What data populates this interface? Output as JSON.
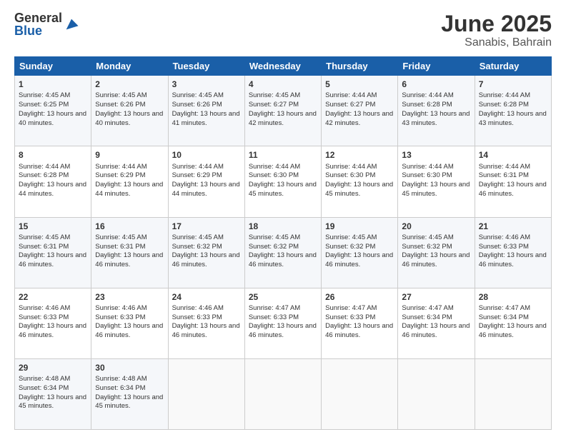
{
  "header": {
    "logo_general": "General",
    "logo_blue": "Blue",
    "month": "June 2025",
    "location": "Sanabis, Bahrain"
  },
  "weekdays": [
    "Sunday",
    "Monday",
    "Tuesday",
    "Wednesday",
    "Thursday",
    "Friday",
    "Saturday"
  ],
  "weeks": [
    [
      {
        "day": "1",
        "sunrise": "Sunrise: 4:45 AM",
        "sunset": "Sunset: 6:25 PM",
        "daylight": "Daylight: 13 hours and 40 minutes."
      },
      {
        "day": "2",
        "sunrise": "Sunrise: 4:45 AM",
        "sunset": "Sunset: 6:26 PM",
        "daylight": "Daylight: 13 hours and 40 minutes."
      },
      {
        "day": "3",
        "sunrise": "Sunrise: 4:45 AM",
        "sunset": "Sunset: 6:26 PM",
        "daylight": "Daylight: 13 hours and 41 minutes."
      },
      {
        "day": "4",
        "sunrise": "Sunrise: 4:45 AM",
        "sunset": "Sunset: 6:27 PM",
        "daylight": "Daylight: 13 hours and 42 minutes."
      },
      {
        "day": "5",
        "sunrise": "Sunrise: 4:44 AM",
        "sunset": "Sunset: 6:27 PM",
        "daylight": "Daylight: 13 hours and 42 minutes."
      },
      {
        "day": "6",
        "sunrise": "Sunrise: 4:44 AM",
        "sunset": "Sunset: 6:28 PM",
        "daylight": "Daylight: 13 hours and 43 minutes."
      },
      {
        "day": "7",
        "sunrise": "Sunrise: 4:44 AM",
        "sunset": "Sunset: 6:28 PM",
        "daylight": "Daylight: 13 hours and 43 minutes."
      }
    ],
    [
      {
        "day": "8",
        "sunrise": "Sunrise: 4:44 AM",
        "sunset": "Sunset: 6:28 PM",
        "daylight": "Daylight: 13 hours and 44 minutes."
      },
      {
        "day": "9",
        "sunrise": "Sunrise: 4:44 AM",
        "sunset": "Sunset: 6:29 PM",
        "daylight": "Daylight: 13 hours and 44 minutes."
      },
      {
        "day": "10",
        "sunrise": "Sunrise: 4:44 AM",
        "sunset": "Sunset: 6:29 PM",
        "daylight": "Daylight: 13 hours and 44 minutes."
      },
      {
        "day": "11",
        "sunrise": "Sunrise: 4:44 AM",
        "sunset": "Sunset: 6:30 PM",
        "daylight": "Daylight: 13 hours and 45 minutes."
      },
      {
        "day": "12",
        "sunrise": "Sunrise: 4:44 AM",
        "sunset": "Sunset: 6:30 PM",
        "daylight": "Daylight: 13 hours and 45 minutes."
      },
      {
        "day": "13",
        "sunrise": "Sunrise: 4:44 AM",
        "sunset": "Sunset: 6:30 PM",
        "daylight": "Daylight: 13 hours and 45 minutes."
      },
      {
        "day": "14",
        "sunrise": "Sunrise: 4:44 AM",
        "sunset": "Sunset: 6:31 PM",
        "daylight": "Daylight: 13 hours and 46 minutes."
      }
    ],
    [
      {
        "day": "15",
        "sunrise": "Sunrise: 4:45 AM",
        "sunset": "Sunset: 6:31 PM",
        "daylight": "Daylight: 13 hours and 46 minutes."
      },
      {
        "day": "16",
        "sunrise": "Sunrise: 4:45 AM",
        "sunset": "Sunset: 6:31 PM",
        "daylight": "Daylight: 13 hours and 46 minutes."
      },
      {
        "day": "17",
        "sunrise": "Sunrise: 4:45 AM",
        "sunset": "Sunset: 6:32 PM",
        "daylight": "Daylight: 13 hours and 46 minutes."
      },
      {
        "day": "18",
        "sunrise": "Sunrise: 4:45 AM",
        "sunset": "Sunset: 6:32 PM",
        "daylight": "Daylight: 13 hours and 46 minutes."
      },
      {
        "day": "19",
        "sunrise": "Sunrise: 4:45 AM",
        "sunset": "Sunset: 6:32 PM",
        "daylight": "Daylight: 13 hours and 46 minutes."
      },
      {
        "day": "20",
        "sunrise": "Sunrise: 4:45 AM",
        "sunset": "Sunset: 6:32 PM",
        "daylight": "Daylight: 13 hours and 46 minutes."
      },
      {
        "day": "21",
        "sunrise": "Sunrise: 4:46 AM",
        "sunset": "Sunset: 6:33 PM",
        "daylight": "Daylight: 13 hours and 46 minutes."
      }
    ],
    [
      {
        "day": "22",
        "sunrise": "Sunrise: 4:46 AM",
        "sunset": "Sunset: 6:33 PM",
        "daylight": "Daylight: 13 hours and 46 minutes."
      },
      {
        "day": "23",
        "sunrise": "Sunrise: 4:46 AM",
        "sunset": "Sunset: 6:33 PM",
        "daylight": "Daylight: 13 hours and 46 minutes."
      },
      {
        "day": "24",
        "sunrise": "Sunrise: 4:46 AM",
        "sunset": "Sunset: 6:33 PM",
        "daylight": "Daylight: 13 hours and 46 minutes."
      },
      {
        "day": "25",
        "sunrise": "Sunrise: 4:47 AM",
        "sunset": "Sunset: 6:33 PM",
        "daylight": "Daylight: 13 hours and 46 minutes."
      },
      {
        "day": "26",
        "sunrise": "Sunrise: 4:47 AM",
        "sunset": "Sunset: 6:33 PM",
        "daylight": "Daylight: 13 hours and 46 minutes."
      },
      {
        "day": "27",
        "sunrise": "Sunrise: 4:47 AM",
        "sunset": "Sunset: 6:34 PM",
        "daylight": "Daylight: 13 hours and 46 minutes."
      },
      {
        "day": "28",
        "sunrise": "Sunrise: 4:47 AM",
        "sunset": "Sunset: 6:34 PM",
        "daylight": "Daylight: 13 hours and 46 minutes."
      }
    ],
    [
      {
        "day": "29",
        "sunrise": "Sunrise: 4:48 AM",
        "sunset": "Sunset: 6:34 PM",
        "daylight": "Daylight: 13 hours and 45 minutes."
      },
      {
        "day": "30",
        "sunrise": "Sunrise: 4:48 AM",
        "sunset": "Sunset: 6:34 PM",
        "daylight": "Daylight: 13 hours and 45 minutes."
      },
      null,
      null,
      null,
      null,
      null
    ]
  ]
}
